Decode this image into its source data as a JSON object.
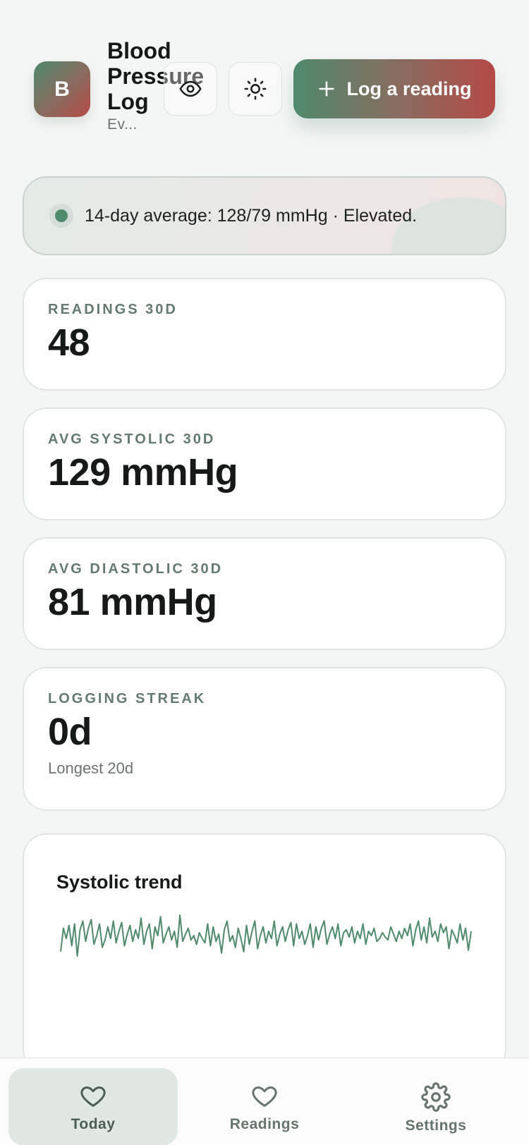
{
  "header": {
    "avatar_letter": "B",
    "title": "Blood Pressure Log",
    "subtitle": "Ev...",
    "log_button_label": "Log a reading"
  },
  "banner": {
    "text": "14-day average: 128/79 mmHg · Elevated."
  },
  "stats": [
    {
      "label": "READINGS 30D",
      "value": "48"
    },
    {
      "label": "AVG SYSTOLIC 30D",
      "value": "129 mmHg"
    },
    {
      "label": "AVG DIASTOLIC 30D",
      "value": "81 mmHg"
    },
    {
      "label": "LOGGING STREAK",
      "value": "0d",
      "sub": "Longest 20d"
    }
  ],
  "chart": {
    "title": "Systolic trend"
  },
  "chart_data": {
    "type": "line",
    "title": "Systolic trend",
    "series": [
      {
        "values": [
          122,
          138,
          131,
          140,
          126,
          141,
          119,
          137,
          143,
          129,
          138,
          144,
          127,
          133,
          141,
          125,
          130,
          139,
          131,
          143,
          128,
          136,
          142,
          126,
          134,
          140,
          129,
          137,
          131,
          145,
          127,
          136,
          141,
          124,
          139,
          133,
          146,
          128,
          134,
          139,
          130,
          136,
          125,
          147,
          129,
          134,
          138,
          130,
          133,
          127,
          135,
          131,
          128,
          141,
          126,
          139,
          129,
          134,
          121,
          137,
          143,
          129,
          133,
          125,
          138,
          131,
          122,
          140,
          127,
          136,
          143,
          124,
          133,
          139,
          128,
          136,
          131,
          143,
          126,
          134,
          139,
          129,
          137,
          142,
          126,
          141,
          131,
          136,
          127,
          133,
          141,
          125,
          139,
          130,
          138,
          143,
          127,
          134,
          139,
          131,
          141,
          126,
          135,
          137,
          132,
          139,
          128,
          136,
          131,
          141,
          127,
          136,
          133,
          138,
          129,
          131,
          135,
          132,
          130,
          139,
          134,
          129,
          136,
          131,
          138,
          133,
          141,
          126,
          137,
          143,
          130,
          139,
          128,
          145,
          132,
          136,
          129,
          141,
          135,
          139,
          124,
          137,
          133,
          128,
          141,
          130,
          138,
          123,
          136
        ]
      }
    ],
    "color": "#4f8a6c"
  },
  "nav": {
    "items": [
      {
        "label": "Today",
        "icon": "heart-icon",
        "active": true
      },
      {
        "label": "Readings",
        "icon": "heart-icon",
        "active": false
      },
      {
        "label": "Settings",
        "icon": "gear-icon",
        "active": false
      }
    ]
  },
  "colors": {
    "brand_green": "#4f8a6c",
    "brand_red": "#b54a46",
    "background": "#f4f6f5"
  }
}
